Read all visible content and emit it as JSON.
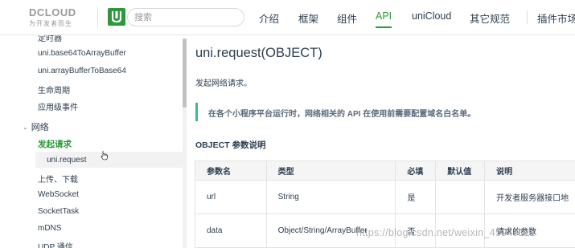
{
  "header": {
    "logo_text": "DCLOUD",
    "logo_sub": "为开发者而生",
    "search_placeholder": "搜索",
    "nav": [
      {
        "label": "介绍"
      },
      {
        "label": "框架"
      },
      {
        "label": "组件"
      },
      {
        "label": "API",
        "active": true
      },
      {
        "label": "uniCloud"
      },
      {
        "label": "其它规范"
      },
      {
        "label": "插件市场"
      }
    ]
  },
  "sidebar": {
    "items_before": [
      "定时器",
      "uni.base64ToArrayBuffer",
      "uni.arrayBufferToBase64",
      "生命周期",
      "应用级事件"
    ],
    "group_label": "网络",
    "subgroup_label": "发起请求",
    "active_item": "uni.request",
    "items_after": [
      "上传、下载",
      "WebSocket",
      "SocketTask",
      "mDNS",
      "UDP 通信"
    ]
  },
  "main": {
    "title": "uni.request(OBJECT)",
    "description": "发起网络请求。",
    "tip": "在各个小程序平台运行时，网络相关的 API 在使用前需要配置域名白名单。",
    "section_title": "OBJECT 参数说明",
    "table": {
      "headers": [
        "参数名",
        "类型",
        "必填",
        "默认值",
        "说明"
      ],
      "rows": [
        [
          "url",
          "String",
          "是",
          "",
          "开发者服务器接口地"
        ],
        [
          "data",
          "Object/String/ArrayBuffer",
          "否",
          "",
          "请求的参数"
        ]
      ]
    }
  },
  "watermark": "https://blog.csdn.net/weixin_45949112",
  "colors": {
    "accent": "#2b9939",
    "tip_border": "#42b983",
    "text": "#2c3e50"
  }
}
